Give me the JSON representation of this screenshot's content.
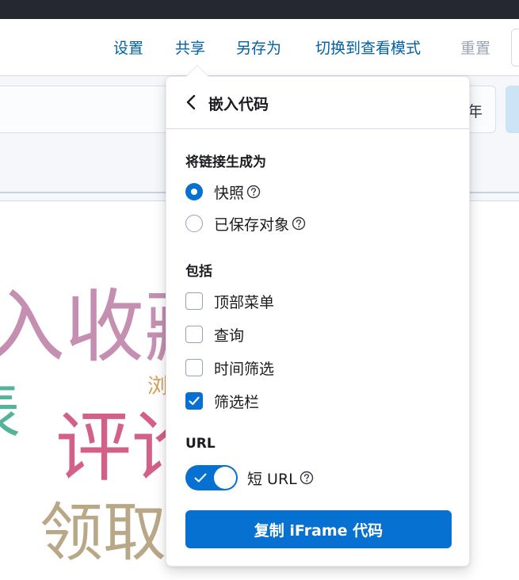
{
  "header": {
    "menu": [
      {
        "label": "设置",
        "disabled": false
      },
      {
        "label": "共享",
        "disabled": false
      },
      {
        "label": "另存为",
        "disabled": false
      },
      {
        "label": "切换到查看模式",
        "disabled": false
      },
      {
        "label": "重置",
        "disabled": true
      }
    ]
  },
  "filter": {
    "date_fragment": "年"
  },
  "cloud": {
    "words": [
      {
        "text": "入收藏",
        "color": "#c48fb0"
      },
      {
        "text": "浏",
        "color": "#d4a056"
      },
      {
        "text": "表",
        "color": "#54b399"
      },
      {
        "text": "评论",
        "color": "#d36086"
      },
      {
        "text": "领取",
        "color": "#b9a888"
      }
    ]
  },
  "popover": {
    "title": "嵌入代码",
    "generate_section": "将链接生成为",
    "generate_options": [
      {
        "label": "快照",
        "selected": true
      },
      {
        "label": "已保存对象",
        "selected": false
      }
    ],
    "include_section": "包括",
    "include_options": [
      {
        "label": "顶部菜单",
        "checked": false
      },
      {
        "label": "查询",
        "checked": false
      },
      {
        "label": "时间筛选",
        "checked": false
      },
      {
        "label": "筛选栏",
        "checked": true
      }
    ],
    "url_section": "URL",
    "short_url_label": "短 URL",
    "short_url_enabled": true,
    "copy_button": "复制 iFrame 代码"
  },
  "colors": {
    "accent": "#0771d1",
    "link": "#0061a6",
    "disabled": "#98a2b3",
    "topbar": "#25282f"
  }
}
